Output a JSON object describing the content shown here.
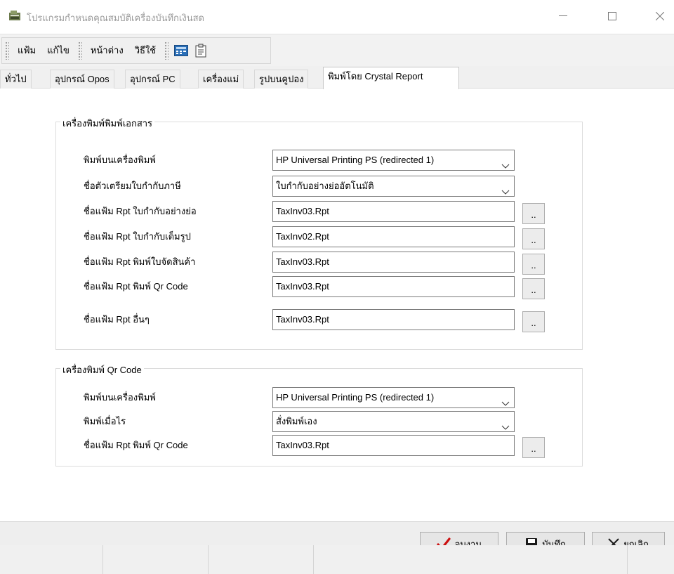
{
  "window": {
    "title": "โปรแกรมกำหนดคุณสมบัติเครื่องบันทึกเงินสด"
  },
  "menu": {
    "file": "แฟ้ม",
    "edit": "แก้ไข",
    "window": "หน้าต่าง",
    "help": "วิธีใช้"
  },
  "toolbar": {
    "icons": [
      "calculator-icon",
      "clipboard-icon"
    ]
  },
  "tabs": [
    {
      "label": "ทั่วไป",
      "active": false
    },
    {
      "label": "อุปกรณ์ Opos",
      "active": false
    },
    {
      "label": "อุปกรณ์ PC",
      "active": false
    },
    {
      "label": "เครื่องแม่",
      "active": false
    },
    {
      "label": "รูปบนคูปอง",
      "active": false
    },
    {
      "label": "พิมพ์โดย Crystal Report",
      "active": true
    }
  ],
  "document_printer": {
    "legend": "เครื่องพิมพ์พิมพ์เอกสาร",
    "printer_label": "พิมพ์บนเครื่องพิมพ์",
    "printer_value": "HP Universal Printing PS (redirected 1)",
    "prep_label": "ชื่อตัวเตรียมใบกำกับภาษี",
    "prep_value": "ใบกำกับอย่างย่ออัตโนมัติ",
    "short_inv_label": "ชื่อแฟ้ม Rpt ใบกำกับอย่างย่อ",
    "short_inv_value": "TaxInv03.Rpt",
    "full_inv_label": "ชื่อแฟ้ม Rpt ใบกำกับเต็มรูป",
    "full_inv_value": "TaxInv02.Rpt",
    "picklist_label": "ชื่อแฟ้ม Rpt พิมพ์ใบจัดสินค้า",
    "picklist_value": "TaxInv03.Rpt",
    "qr_label": "ชื่อแฟ้ม Rpt พิมพ์ Qr Code",
    "qr_value": "TaxInv03.Rpt",
    "other_label": "ชื่อแฟ้ม Rpt อื่นๆ",
    "other_value": "TaxInv03.Rpt"
  },
  "qr_printer": {
    "legend": "เครื่องพิมพ์ Qr Code",
    "printer_label": "พิมพ์บนเครื่องพิมพ์",
    "printer_value": "HP Universal Printing PS (redirected 1)",
    "when_label": "พิมพ์เมื่อไร",
    "when_value": "สั่งพิมพ์เอง",
    "qr_label": "ชื่อแฟ้ม Rpt พิมพ์ Qr Code",
    "qr_value": "TaxInv03.Rpt"
  },
  "browse_label": "..",
  "actions": {
    "finish": "จบงาน",
    "save": "บันทึก",
    "cancel": "ยกเลิก"
  },
  "colors": {
    "check": "#cc1010",
    "save_icon": "#1a1a1a",
    "toolbar_blue": "#2a6fb8"
  }
}
